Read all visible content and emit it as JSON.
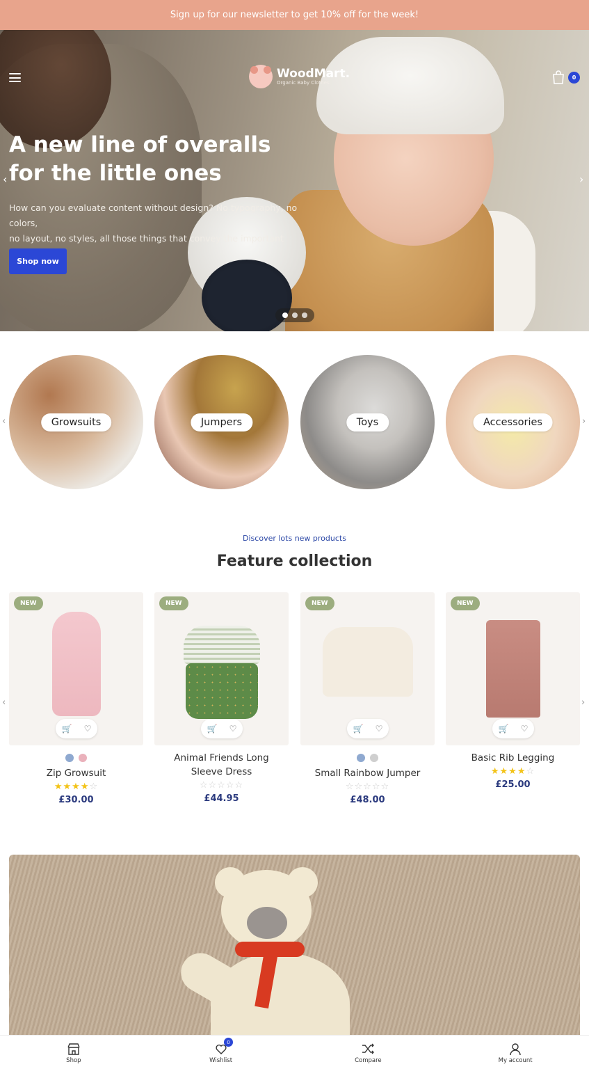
{
  "announcement": "Sign up for our newsletter to get 10% off for the week!",
  "header": {
    "logo_name": "WoodMart.",
    "logo_tagline": "Organic Baby Clothes",
    "cart_count": "0"
  },
  "hero": {
    "title_line1": "A new line of overalls",
    "title_line2": "for the little ones",
    "text_line1": "How can you evaluate content without design? No typography, no colors,",
    "text_line2": "no layout, no styles, all those things that convey the important signals.",
    "button": "Shop now",
    "slides": 3,
    "active_slide": 1
  },
  "categories": [
    {
      "label": "Growsuits"
    },
    {
      "label": "Jumpers"
    },
    {
      "label": "Toys"
    },
    {
      "label": "Accessories"
    }
  ],
  "featured": {
    "kicker": "Discover lots new products",
    "title": "Feature collection",
    "products": [
      {
        "badge": "NEW",
        "name": "Zip Growsuit",
        "price": "£30.00",
        "rating": 4,
        "swatches": [
          "#8fa9d0",
          "#eab1bb"
        ]
      },
      {
        "badge": "NEW",
        "name": "Animal Friends Long Sleeve Dress",
        "price": "£44.95",
        "rating": 0,
        "swatches": []
      },
      {
        "badge": "NEW",
        "name": "Small Rainbow Jumper",
        "price": "£48.00",
        "rating": 0,
        "swatches": [
          "#8fa9d0",
          "#cfcfcf"
        ]
      },
      {
        "badge": "NEW",
        "name": "Basic Rib Legging",
        "price": "£25.00",
        "rating": 4,
        "swatches": []
      }
    ]
  },
  "bottom_nav": [
    {
      "label": "Shop",
      "icon": "store-icon"
    },
    {
      "label": "Wishlist",
      "icon": "heart-icon",
      "count": "0"
    },
    {
      "label": "Compare",
      "icon": "shuffle-icon"
    },
    {
      "label": "My account",
      "icon": "user-icon"
    }
  ],
  "colors": {
    "announcement_bg": "#e8a48c",
    "accent": "#2b47d6",
    "badge": "#9cad7f",
    "price": "#2b3a7e",
    "star": "#f3c317"
  }
}
